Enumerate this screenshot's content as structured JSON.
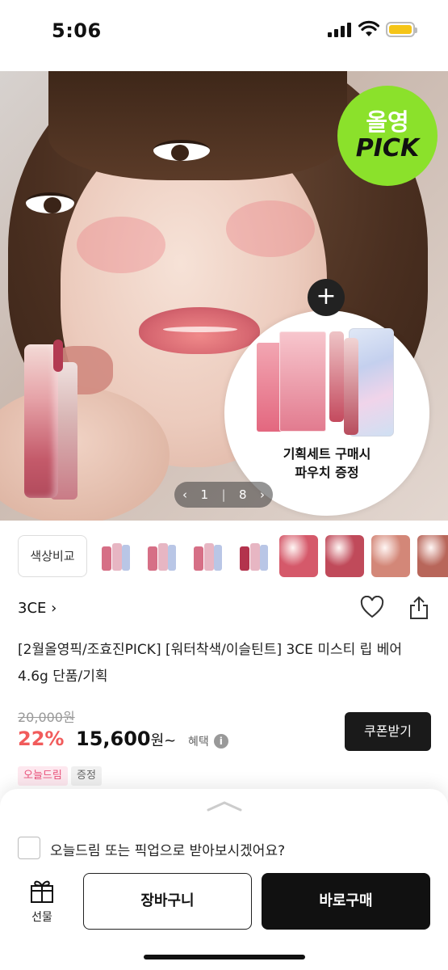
{
  "status_bar": {
    "time": "5:06"
  },
  "hero": {
    "badge_line1": "올영",
    "badge_line2": "PICK",
    "promo_line1": "기획세트 구매시",
    "promo_line2": "파우치 증정",
    "promo_plus": "+",
    "pager_current": "1",
    "pager_sep": "|",
    "pager_total": "8",
    "pager_prev": "‹",
    "pager_next": "›"
  },
  "thumbnails": {
    "compare_label": "색상비교",
    "swatch_colors": [
      "#d5596a",
      "#c04a5a",
      "#d38778",
      "#b8665a"
    ]
  },
  "product": {
    "brand": "3CE",
    "brand_chevron": "›",
    "title": "[2월올영픽/조효진PICK] [워터착색/이슬틴트] 3CE 미스티 립 베어 4.6g 단품/기획",
    "original_price": "20,000원",
    "discount": "22%",
    "price": "15,600",
    "price_suffix": "원~",
    "benefit_label": "혜택",
    "benefit_icon": "i",
    "coupon_button": "쿠폰받기",
    "tags": [
      "오늘드림",
      "증정"
    ]
  },
  "bottom_sheet": {
    "delivery_option": "오늘드림 또는 픽업으로 받아보시겠어요?",
    "gift_label": "선물",
    "cart_button": "장바구니",
    "buy_button": "바로구매"
  },
  "colors": {
    "discount_red": "#f15b5b",
    "pick_green": "#8be12b",
    "dark_button": "#111111"
  },
  "icons": [
    "signal-icon",
    "wifi-icon",
    "battery-icon",
    "heart-icon",
    "share-icon",
    "chevron-up-icon",
    "gift-icon",
    "info-icon"
  ]
}
